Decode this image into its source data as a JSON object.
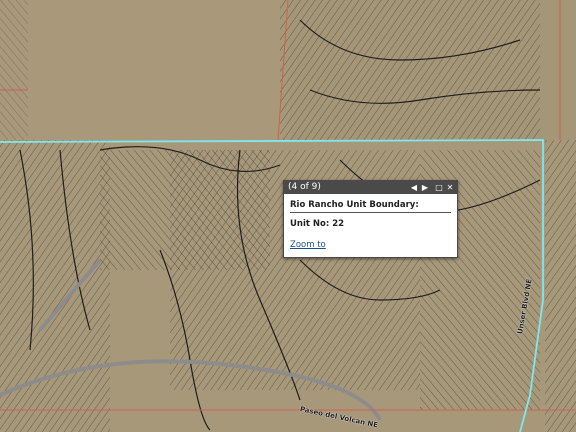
{
  "map": {
    "colors": {
      "terrain": "#a8987a",
      "parcel_line": "#3a3a3a",
      "unit_boundary": "#7ee8f0",
      "parcel_boundary_red": "#d06050",
      "road": "#8a8a8a"
    },
    "road_labels": [
      "Paseo del Volcan NE",
      "Unser Blvd NE"
    ]
  },
  "popup": {
    "counter": "(4 of 9)",
    "title": "Rio Rancho Unit Boundary:",
    "field_label": "Unit No: 22",
    "zoom_link": "Zoom to",
    "controls": {
      "prev_icon": "◀",
      "next_icon": "▶",
      "maximize_icon": "□",
      "close_icon": "✕"
    }
  }
}
